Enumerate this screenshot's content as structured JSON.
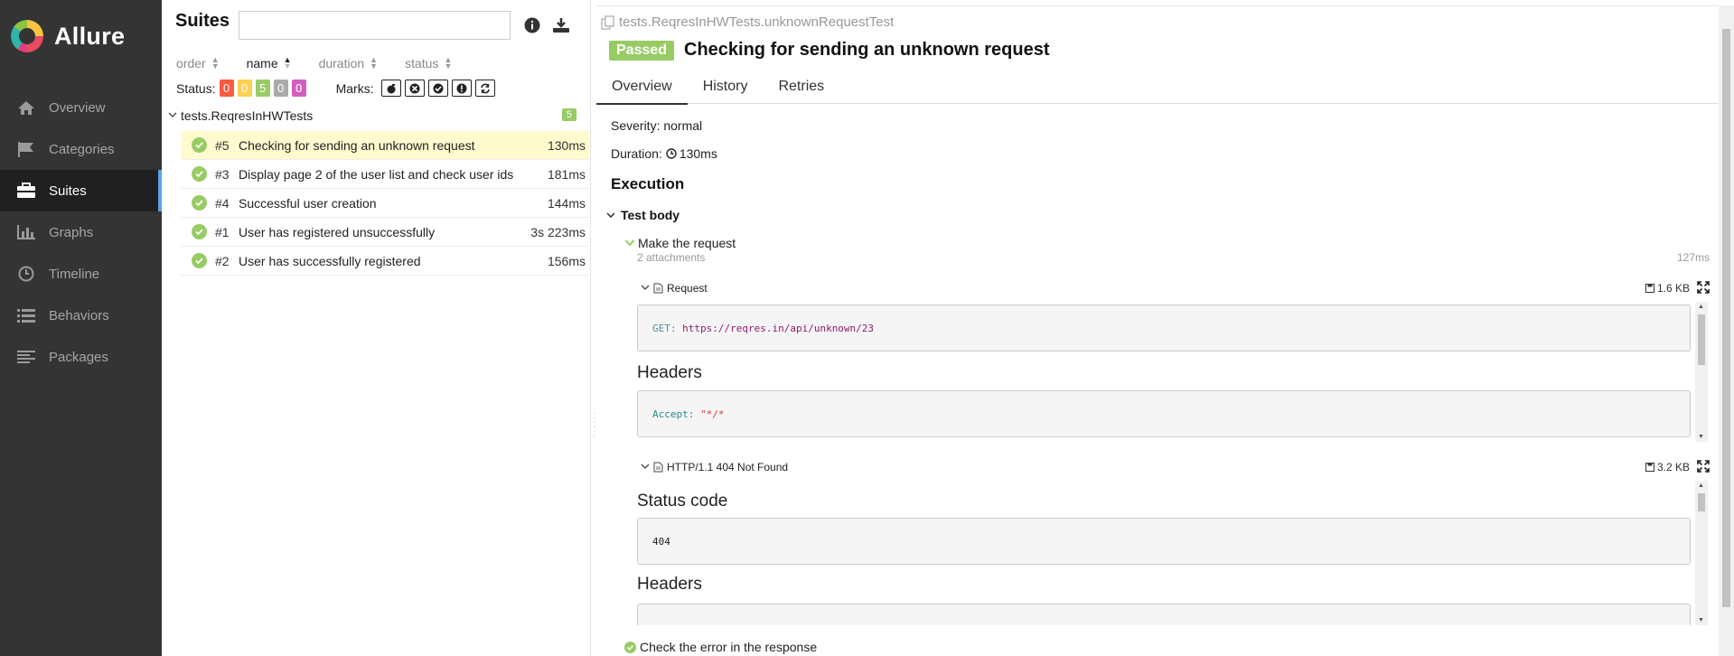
{
  "app": {
    "name": "Allure"
  },
  "sidebar": {
    "items": [
      {
        "label": "Overview",
        "icon": "home-icon",
        "active": false
      },
      {
        "label": "Categories",
        "icon": "flag-icon",
        "active": false
      },
      {
        "label": "Suites",
        "icon": "briefcase-icon",
        "active": true
      },
      {
        "label": "Graphs",
        "icon": "bar-chart-icon",
        "active": false
      },
      {
        "label": "Timeline",
        "icon": "clock-icon",
        "active": false
      },
      {
        "label": "Behaviors",
        "icon": "list-icon",
        "active": false
      },
      {
        "label": "Packages",
        "icon": "align-left-icon",
        "active": false
      }
    ]
  },
  "suites": {
    "title": "Suites",
    "search": {
      "value": "",
      "placeholder": ""
    },
    "sorters": {
      "order": "order",
      "name": "name",
      "duration": "duration",
      "status": "status"
    },
    "status_label": "Status:",
    "status_counts": [
      {
        "value": "0",
        "color": "#fd5a3e"
      },
      {
        "value": "0",
        "color": "#ffd050"
      },
      {
        "value": "5",
        "color": "#97cc64"
      },
      {
        "value": "0",
        "color": "#aaaaaa"
      },
      {
        "value": "0",
        "color": "#d35ebe"
      }
    ],
    "marks_label": "Marks:",
    "group": {
      "name": "tests.ReqresInHWTests",
      "count": "5"
    },
    "tests": [
      {
        "num": "#5",
        "name": "Checking for sending an unknown request",
        "duration": "130ms",
        "selected": true
      },
      {
        "num": "#3",
        "name": "Display page 2 of the user list and check user ids",
        "duration": "181ms",
        "selected": false
      },
      {
        "num": "#4",
        "name": "Successful user creation",
        "duration": "144ms",
        "selected": false
      },
      {
        "num": "#1",
        "name": "User has registered unsuccessfully",
        "duration": "3s 223ms",
        "selected": false
      },
      {
        "num": "#2",
        "name": "User has successfully registered",
        "duration": "156ms",
        "selected": false
      }
    ]
  },
  "detail": {
    "path": "tests.ReqresInHWTests.unknownRequestTest",
    "status": "Passed",
    "title": "Checking for sending an unknown request",
    "tabs": [
      "Overview",
      "History",
      "Retries"
    ],
    "severity": "Severity: normal",
    "duration_label": "Duration:",
    "duration": "130ms",
    "execution": "Execution",
    "test_body": "Test body",
    "step": {
      "name": "Make the request",
      "attachments": "2 attachments",
      "duration": "127ms"
    },
    "request": {
      "name": "Request",
      "size": "1.6 KB",
      "method": "GET",
      "url": "https://reqres.in/api/unknown/23",
      "headers_title": "Headers",
      "header_key": "Accept",
      "header_value": "\"*/*"
    },
    "response": {
      "name": "HTTP/1.1 404 Not Found",
      "size": "3.2 KB",
      "status_code_title": "Status code",
      "status_code": "404",
      "headers_title": "Headers"
    },
    "next_step": "Check the error in the response"
  }
}
